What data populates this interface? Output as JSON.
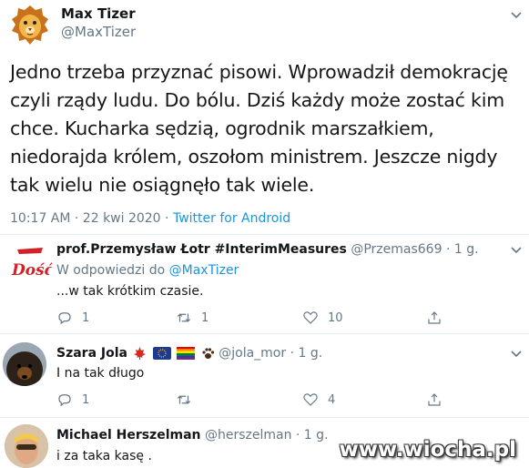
{
  "tweet": {
    "author_name": "Max Tizer",
    "author_handle": "@MaxTizer",
    "lines": [
      "Jedno trzeba przyznać pisowi. Wprowadził demokrację",
      "czyli rządy ludu. Do bólu. Dziś każdy może zostać kim",
      "chce. Kucharka sędzią, ogrodnik marszałkiem,",
      "niedorajda królem, oszołom ministrem. Jeszcze nigdy",
      "tak wielu nie osiągnęło tak wiele."
    ],
    "timestamp": "10:17 AM · 22 kwi 2020",
    "separator": " · ",
    "source": "Twitter for Android"
  },
  "replies": [
    {
      "name": "prof.Przemysław Łotr #InterimMeasures",
      "handle": "@Przemas669",
      "time": "· 1 g.",
      "reply_prefix": "W odpowiedzi do ",
      "reply_to": "@MaxTizer",
      "text": "...w tak krótkim czasie.",
      "counts": {
        "replies": "1",
        "retweets": "1",
        "likes": "10"
      },
      "avatar_text": "Dość"
    },
    {
      "name": "Szara Jola",
      "handle": "@jola_mor",
      "time": "· 1 g.",
      "text": "I na tak długo",
      "counts": {
        "replies": "1",
        "retweets": "",
        "likes": "4"
      }
    },
    {
      "name": "Michael Herszelman",
      "handle": "@herszelman",
      "time": "· 1 g.",
      "text": "i za taka kasę ."
    }
  ],
  "watermark": "www.wiocha.pl",
  "colors": {
    "link": "#1b95e0",
    "muted": "#657786",
    "divider": "#e6ecf0"
  },
  "icons": [
    "lion-avatar",
    "chevron-down-icon",
    "reply-icon",
    "retweet-icon",
    "like-icon",
    "share-icon",
    "maple-leaf-icon",
    "eu-flag-icon",
    "rainbow-flag-icon",
    "paw-icon"
  ]
}
